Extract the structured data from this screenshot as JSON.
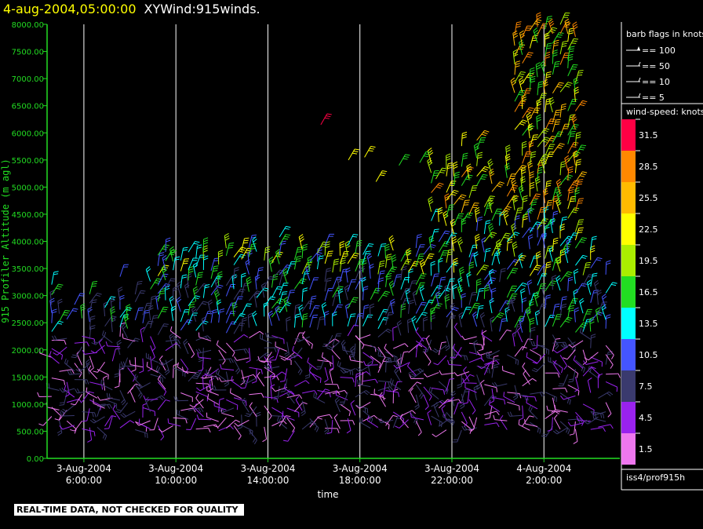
{
  "header": {
    "timestamp": "4-aug-2004,05:00:00",
    "product": "XYWind:915winds."
  },
  "chart_data": {
    "type": "wind-barb",
    "ylabel": "915 Profiler Altitude (m agl)",
    "xlabel": "time",
    "ylim": [
      0,
      8000
    ],
    "yticks": [
      "0.00",
      "500.00",
      "1000.00",
      "1500.00",
      "2000.00",
      "2500.00",
      "3000.00",
      "3500.00",
      "4000.00",
      "4500.00",
      "5000.00",
      "5500.00",
      "6000.00",
      "6500.00",
      "7000.00",
      "7500.00",
      "8000.00"
    ],
    "xlim_hours": [
      4.4,
      29.3
    ],
    "xticks": [
      {
        "hour": 6,
        "date": "3-Aug-2004",
        "time": "6:00:00"
      },
      {
        "hour": 10,
        "date": "3-Aug-2004",
        "time": "10:00:00"
      },
      {
        "hour": 14,
        "date": "3-Aug-2004",
        "time": "14:00:00"
      },
      {
        "hour": 18,
        "date": "3-Aug-2004",
        "time": "18:00:00"
      },
      {
        "hour": 22,
        "date": "3-Aug-2004",
        "time": "22:00:00"
      },
      {
        "hour": 26,
        "date": "4-Aug-2004",
        "time": "2:00:00"
      }
    ],
    "vertical_gridlines": true
  },
  "legend": {
    "barb_title": "barb flags in knots",
    "barb_entries": [
      "== 100",
      "== 50",
      "== 10",
      "== 5"
    ],
    "speed_title": "wind-speed: knots",
    "speed_levels": [
      {
        "label": "31.5",
        "color": "#ff0044"
      },
      {
        "label": "28.5",
        "color": "#ff8800"
      },
      {
        "label": "25.5",
        "color": "#ffbb00"
      },
      {
        "label": "22.5",
        "color": "#ffff00"
      },
      {
        "label": "19.5",
        "color": "#aaee00"
      },
      {
        "label": "16.5",
        "color": "#22dd22"
      },
      {
        "label": "13.5",
        "color": "#00ffff"
      },
      {
        "label": "10.5",
        "color": "#4455ff"
      },
      {
        "label": "7.5",
        "color": "#3a3a6e"
      },
      {
        "label": "4.5",
        "color": "#9922ee"
      },
      {
        "label": "1.5",
        "color": "#ee77ee"
      }
    ],
    "station": "iss4/prof915h"
  },
  "footer": {
    "note": "REAL-TIME DATA, NOT CHECKED FOR QUALITY"
  },
  "colors": {
    "axis": "#22dd22",
    "grid": "#ffffff",
    "text": "#ffffff",
    "title_time": "#ffff00"
  }
}
